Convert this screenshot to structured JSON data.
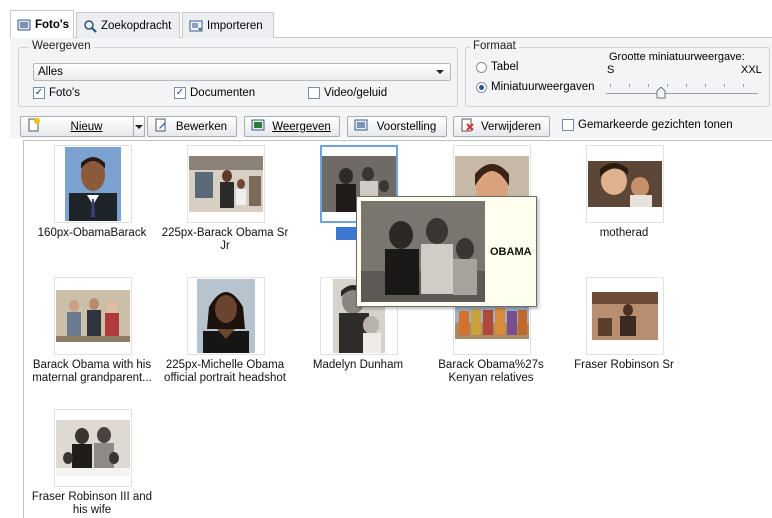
{
  "tabs": [
    {
      "label": "Foto's",
      "icon": "photo-tab-icon",
      "active": true
    },
    {
      "label": "Zoekopdracht",
      "icon": "magnifier-icon",
      "active": false
    },
    {
      "label": "Importeren",
      "icon": "import-icon",
      "active": false
    }
  ],
  "view": {
    "legend": "Weergeven",
    "select_value": "Alles",
    "checkboxes": [
      {
        "label": "Foto's",
        "checked": true
      },
      {
        "label": "Documenten",
        "checked": true
      },
      {
        "label": "Video/geluid",
        "checked": false
      }
    ]
  },
  "format": {
    "legend": "Formaat",
    "options": [
      {
        "label": "Tabel",
        "selected": false
      },
      {
        "label": "Miniatuurweergaven",
        "selected": true
      }
    ],
    "size_label": "Grootte miniatuurweergave:",
    "size_min": "S",
    "size_max": "XXL",
    "size_level": 0.35
  },
  "toolbar": {
    "new_label": "Nieuw",
    "edit_label": "Bewerken",
    "view_label": "Weergeven",
    "show_label": "Voorstelling",
    "delete_label": "Verwijderen",
    "faces_label": "Gemarkeerde gezichten tonen",
    "faces_checked": false
  },
  "photos": [
    {
      "caption": "160px-ObamaBarack",
      "selected": false
    },
    {
      "caption": "225px-Barack Obama Sr Jr",
      "selected": false
    },
    {
      "caption": "OB",
      "selected": true
    },
    {
      "caption": "",
      "selected": false
    },
    {
      "caption": "motherad",
      "selected": false
    },
    {
      "caption": "Barack Obama with his maternal grandparent...",
      "selected": false
    },
    {
      "caption": "225px-Michelle Obama official portrait headshot",
      "selected": false
    },
    {
      "caption": "Madelyn Dunham",
      "selected": false
    },
    {
      "caption": "Barack Obama%27s Kenyan relatives",
      "selected": false
    },
    {
      "caption": "Fraser Robinson Sr",
      "selected": false
    },
    {
      "caption": "Fraser Robinson III and his wife",
      "selected": false
    }
  ],
  "tooltip": {
    "title": "OBAMA"
  },
  "colors": {
    "selection": "#3b79d1",
    "selection_border": "#6fa2e0",
    "panel": "#f3f4f6",
    "tooltip_bg": "#fffff0"
  }
}
